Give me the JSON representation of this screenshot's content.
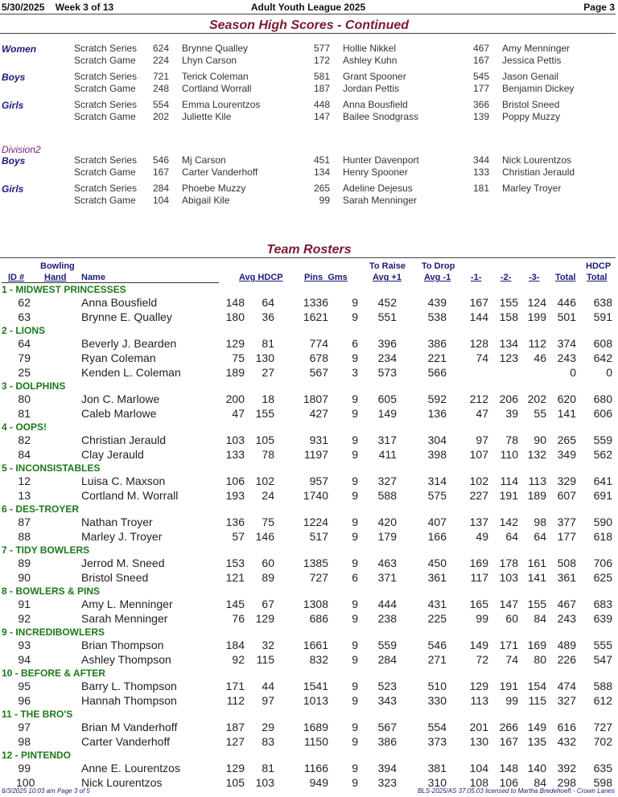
{
  "header": {
    "date": "5/30/2025",
    "week": "Week 3 of 13",
    "league": "Adult Youth League 2025",
    "page": "Page 3"
  },
  "high_scores": {
    "title": "Season High Scores - Continued",
    "groups": [
      {
        "label": "Women",
        "rows": [
          {
            "type": "Scratch Series",
            "e": [
              [
                "624",
                "Brynne Qualley"
              ],
              [
                "577",
                "Hollie Nikkel"
              ],
              [
                "467",
                "Amy Menninger"
              ]
            ]
          },
          {
            "type": "Scratch Game",
            "e": [
              [
                "224",
                "Lhyn Carson"
              ],
              [
                "172",
                "Ashley Kuhn"
              ],
              [
                "167",
                "Jessica Pettis"
              ]
            ]
          }
        ]
      },
      {
        "label": "Boys",
        "rows": [
          {
            "type": "Scratch Series",
            "e": [
              [
                "721",
                "Terick Coleman"
              ],
              [
                "581",
                "Grant Spooner"
              ],
              [
                "545",
                "Jason Genail"
              ]
            ]
          },
          {
            "type": "Scratch Game",
            "e": [
              [
                "248",
                "Cortland Worrall"
              ],
              [
                "187",
                "Jordan Pettis"
              ],
              [
                "177",
                "Benjamin Dickey"
              ]
            ]
          }
        ]
      },
      {
        "label": "Girls",
        "rows": [
          {
            "type": "Scratch Series",
            "e": [
              [
                "554",
                "Emma Lourentzos"
              ],
              [
                "448",
                "Anna Bousfield"
              ],
              [
                "366",
                "Bristol Sneed"
              ]
            ]
          },
          {
            "type": "Scratch Game",
            "e": [
              [
                "202",
                "Juliette Kile"
              ],
              [
                "147",
                "Bailee Snodgrass"
              ],
              [
                "139",
                "Poppy Muzzy"
              ]
            ]
          }
        ]
      }
    ],
    "division2_label": "Division2",
    "groups2": [
      {
        "label": "Boys",
        "rows": [
          {
            "type": "Scratch Series",
            "e": [
              [
                "546",
                "Mj Carson"
              ],
              [
                "451",
                "Hunter Davenport"
              ],
              [
                "344",
                "Nick Lourentzos"
              ]
            ]
          },
          {
            "type": "Scratch Game",
            "e": [
              [
                "167",
                "Carter Vanderhoff"
              ],
              [
                "134",
                "Henry Spooner"
              ],
              [
                "133",
                "Christian Jerauld"
              ]
            ]
          }
        ]
      },
      {
        "label": "Girls",
        "rows": [
          {
            "type": "Scratch Series",
            "e": [
              [
                "284",
                "Phoebe Muzzy"
              ],
              [
                "265",
                "Adeline Dejesus"
              ],
              [
                "181",
                "Marley Troyer"
              ]
            ]
          },
          {
            "type": "Scratch Game",
            "e": [
              [
                "104",
                "Abigail Kile"
              ],
              [
                "99",
                "Sarah Menninger"
              ],
              [
                "",
                ""
              ]
            ]
          }
        ]
      }
    ]
  },
  "rosters": {
    "title": "Team Rosters",
    "headers": {
      "id": "ID #",
      "bowling": "Bowling",
      "hand": "Hand",
      "name": "Name",
      "avg_hdcp": "Avg HDCP",
      "pins_gms": "Pins  Gms",
      "to_raise": "To Raise",
      "to_raise_sub": "Avg +1",
      "to_drop": "To Drop",
      "to_drop_sub": "Avg -1",
      "g1": "-1-",
      "g2": "-2-",
      "g3": "-3-",
      "total": "Total",
      "hdcp": "HDCP",
      "hdcp_total": "Total"
    },
    "teams": [
      {
        "name": "1 - MIDWEST PRINCESSES",
        "players": [
          [
            "62",
            "Anna Bousfield",
            "148",
            "64",
            "1336",
            "9",
            "452",
            "439",
            "167",
            "155",
            "124",
            "446",
            "638"
          ],
          [
            "63",
            "Brynne E. Qualley",
            "180",
            "36",
            "1621",
            "9",
            "551",
            "538",
            "144",
            "158",
            "199",
            "501",
            "591"
          ]
        ]
      },
      {
        "name": "2 - LIONS",
        "players": [
          [
            "64",
            "Beverly J. Bearden",
            "129",
            "81",
            "774",
            "6",
            "396",
            "386",
            "128",
            "134",
            "112",
            "374",
            "608"
          ],
          [
            "79",
            "Ryan Coleman",
            "75",
            "130",
            "678",
            "9",
            "234",
            "221",
            "74",
            "123",
            "46",
            "243",
            "642"
          ],
          [
            "25",
            "Kenden L. Coleman",
            "189",
            "27",
            "567",
            "3",
            "573",
            "566",
            "",
            "",
            "",
            "0",
            "0"
          ]
        ]
      },
      {
        "name": "3 - DOLPHINS",
        "players": [
          [
            "80",
            "Jon C. Marlowe",
            "200",
            "18",
            "1807",
            "9",
            "605",
            "592",
            "212",
            "206",
            "202",
            "620",
            "680"
          ],
          [
            "81",
            "Caleb Marlowe",
            "47",
            "155",
            "427",
            "9",
            "149",
            "136",
            "47",
            "39",
            "55",
            "141",
            "606"
          ]
        ]
      },
      {
        "name": "4 - OOPS!",
        "players": [
          [
            "82",
            "Christian Jerauld",
            "103",
            "105",
            "931",
            "9",
            "317",
            "304",
            "97",
            "78",
            "90",
            "265",
            "559"
          ],
          [
            "84",
            "Clay Jerauld",
            "133",
            "78",
            "1197",
            "9",
            "411",
            "398",
            "107",
            "110",
            "132",
            "349",
            "562"
          ]
        ]
      },
      {
        "name": "5 - INCONSISTABLES",
        "players": [
          [
            "12",
            "Luisa C. Maxson",
            "106",
            "102",
            "957",
            "9",
            "327",
            "314",
            "102",
            "114",
            "113",
            "329",
            "641"
          ],
          [
            "13",
            "Cortland M. Worrall",
            "193",
            "24",
            "1740",
            "9",
            "588",
            "575",
            "227",
            "191",
            "189",
            "607",
            "691"
          ]
        ]
      },
      {
        "name": "6 - DES-TROYER",
        "players": [
          [
            "87",
            "Nathan Troyer",
            "136",
            "75",
            "1224",
            "9",
            "420",
            "407",
            "137",
            "142",
            "98",
            "377",
            "590"
          ],
          [
            "88",
            "Marley J. Troyer",
            "57",
            "146",
            "517",
            "9",
            "179",
            "166",
            "49",
            "64",
            "64",
            "177",
            "618"
          ]
        ]
      },
      {
        "name": "7 - TIDY BOWLERS",
        "players": [
          [
            "89",
            "Jerrod M. Sneed",
            "153",
            "60",
            "1385",
            "9",
            "463",
            "450",
            "169",
            "178",
            "161",
            "508",
            "706"
          ],
          [
            "90",
            "Bristol Sneed",
            "121",
            "89",
            "727",
            "6",
            "371",
            "361",
            "117",
            "103",
            "141",
            "361",
            "625"
          ]
        ]
      },
      {
        "name": "8 - BOWLERS & PINS",
        "players": [
          [
            "91",
            "Amy L. Menninger",
            "145",
            "67",
            "1308",
            "9",
            "444",
            "431",
            "165",
            "147",
            "155",
            "467",
            "683"
          ],
          [
            "92",
            "Sarah Menninger",
            "76",
            "129",
            "686",
            "9",
            "238",
            "225",
            "99",
            "60",
            "84",
            "243",
            "639"
          ]
        ]
      },
      {
        "name": "9 - INCREDIBOWLERS",
        "players": [
          [
            "93",
            "Brian Thompson",
            "184",
            "32",
            "1661",
            "9",
            "559",
            "546",
            "149",
            "171",
            "169",
            "489",
            "555"
          ],
          [
            "94",
            "Ashley Thompson",
            "92",
            "115",
            "832",
            "9",
            "284",
            "271",
            "72",
            "74",
            "80",
            "226",
            "547"
          ]
        ]
      },
      {
        "name": "10 - BEFORE & AFTER",
        "players": [
          [
            "95",
            "Barry L. Thompson",
            "171",
            "44",
            "1541",
            "9",
            "523",
            "510",
            "129",
            "191",
            "154",
            "474",
            "588"
          ],
          [
            "96",
            "Hannah Thompson",
            "112",
            "97",
            "1013",
            "9",
            "343",
            "330",
            "113",
            "99",
            "115",
            "327",
            "612"
          ]
        ]
      },
      {
        "name": "11 - THE BRO'S",
        "players": [
          [
            "97",
            "Brian M Vanderhoff",
            "187",
            "29",
            "1689",
            "9",
            "567",
            "554",
            "201",
            "266",
            "149",
            "616",
            "727"
          ],
          [
            "98",
            "Carter Vanderhoff",
            "127",
            "83",
            "1150",
            "9",
            "386",
            "373",
            "130",
            "167",
            "135",
            "432",
            "702"
          ]
        ]
      },
      {
        "name": "12 - PINTENDO",
        "players": [
          [
            "99",
            "Anne E. Lourentzos",
            "129",
            "81",
            "1166",
            "9",
            "394",
            "381",
            "104",
            "148",
            "140",
            "392",
            "635"
          ],
          [
            "100",
            "Nick Lourentzos",
            "105",
            "103",
            "949",
            "9",
            "323",
            "310",
            "108",
            "106",
            "84",
            "298",
            "598"
          ]
        ]
      }
    ]
  },
  "footer": {
    "left": "6/3/2025  10:03 am  Page 3 of 5",
    "right": "BLS-2025/AS 37.05.03 licensed to Martha Bredehoeft - Crown Lanes"
  }
}
